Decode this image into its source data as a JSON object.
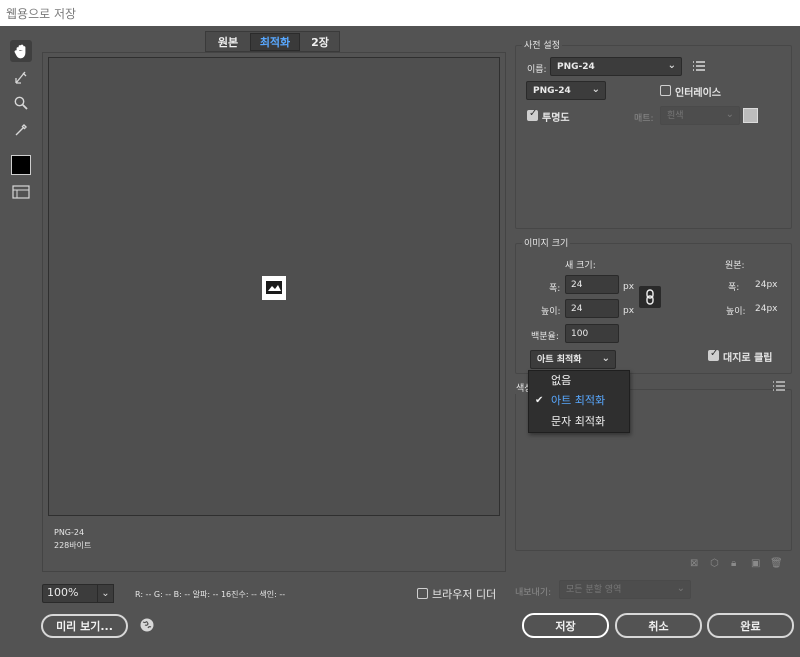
{
  "window": {
    "title": "웹용으로 저장"
  },
  "tools": {
    "hand": "hand-icon",
    "slice_select": "slice-select-icon",
    "zoom": "zoom-icon",
    "eyedropper": "eyedropper-icon",
    "color_swatch": "#000000",
    "toggle_slices": "slice-visibility-icon"
  },
  "tabs": [
    {
      "label": "원본"
    },
    {
      "label": "최적화"
    },
    {
      "label": "2장"
    }
  ],
  "preview": {
    "format": "PNG-24",
    "size": "228바이트"
  },
  "status": {
    "zoom": "100%",
    "readout": "R: --   G: --   B: --   알파: --   16진수: --   색인: --",
    "browser_dither_label": "브라우저 디더"
  },
  "buttons": {
    "preview": "미리 보기...",
    "save": "저장",
    "cancel": "취소",
    "done": "완료"
  },
  "preset": {
    "group_title": "사전 설정",
    "name_label": "이름:",
    "name_value": "PNG-24",
    "format_value": "PNG-24",
    "interlace_label": "인터레이스",
    "interlace_checked": false,
    "transparency_label": "투명도",
    "transparency_checked": true,
    "matte_label": "매트:",
    "matte_value": "흰색"
  },
  "image_size": {
    "group_title": "이미지 크기",
    "new_size_label": "새 크기:",
    "width_label": "폭:",
    "width_value": "24",
    "height_label": "높이:",
    "height_value": "24",
    "unit": "px",
    "percent_label": "백분율:",
    "percent_value": "100",
    "quality_value": "아트 최적화",
    "original_label": "원본:",
    "orig_width_label": "폭:",
    "orig_width_value": "24px",
    "orig_height_label": "높이:",
    "orig_height_value": "24px",
    "clip_label": "대지로 클립",
    "clip_checked": true
  },
  "quality_menu": {
    "items": [
      "없음",
      "아트 최적화",
      "문자 최적화"
    ],
    "selected": "아트 최적화"
  },
  "color_table": {
    "group_title": "색상"
  },
  "export": {
    "label": "내보내기:",
    "value": "모든 분할 영역"
  }
}
